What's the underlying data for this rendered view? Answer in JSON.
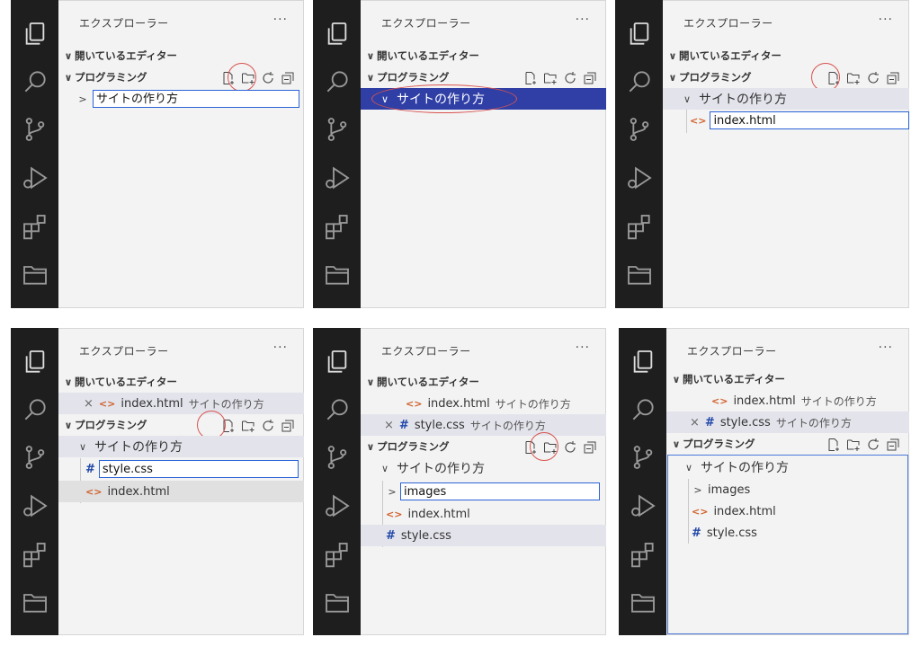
{
  "explorer": {
    "title": "エクスプローラー",
    "more": "···",
    "open_editors": "開いているエディター",
    "workspace": "プログラミング"
  },
  "files": {
    "folder": "サイトの作り方",
    "images": "images",
    "index": "index.html",
    "style": "style.css"
  },
  "icons": {
    "html": "<>",
    "css": "#",
    "close": "×",
    "chev_down": "∨",
    "chev_right": ">"
  },
  "colors": {
    "selection": "#2f3fa6",
    "ring": "#d9534f",
    "input_border": "#2a63d6"
  }
}
